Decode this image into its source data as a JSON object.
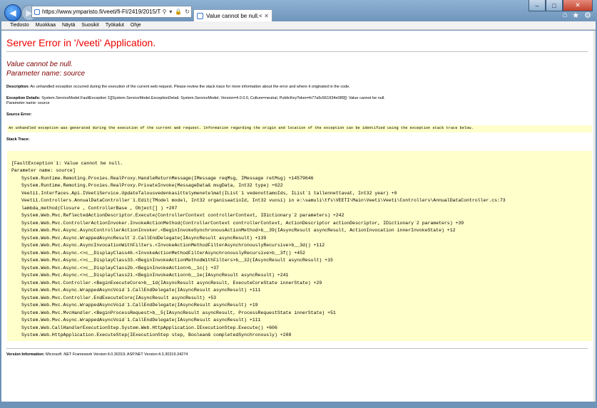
{
  "browser": {
    "url": "https://www.ymparisto.fi/veeti/fi-FI/2419/2015/Talousved",
    "tab_label": "Value cannot be null.<br>P...",
    "menu": [
      "Tiedosto",
      "Muokkaa",
      "Näytä",
      "Suosikit",
      "Työkalut",
      "Ohje"
    ]
  },
  "page": {
    "title": "Server Error in '/veeti' Application.",
    "error_message_line1": "Value cannot be null.",
    "error_message_line2": "Parameter name: source",
    "description_label": "Description:",
    "description_text": "An unhandled exception occurred during the execution of the current web request. Please review the stack trace for more information about the error and where it originated in the code.",
    "exception_label": "Exception Details:",
    "exception_text": "System.ServiceModel.FaultException`1[[System.ServiceModel.ExceptionDetail, System.ServiceModel, Version=4.0.0.0, Culture=neutral, PublicKeyToken=b77a5c561934e089]]: Value cannot be null.",
    "exception_text2": "Parameter name: source",
    "source_error_label": "Source Error:",
    "source_error_text": "An unhandled exception was generated during the execution of the current web request. Information regarding the origin and location of the exception can be identified using the exception stack trace below.",
    "stack_trace_label": "Stack Trace:",
    "stack_trace": [
      "[FaultException`1: Value cannot be null.",
      "Parameter name: source]",
      "System.Runtime.Remoting.Proxies.RealProxy.HandleReturnMessage(IMessage reqMsg, IMessage retMsg) +14579646",
      "System.Runtime.Remoting.Proxies.RealProxy.PrivateInvoke(MessageData& msgData, Int32 type) +622",
      "Veeti1.Interfaces.Api.IVeetiService.UpdateTalousvedenkasittelymenetelmat(IList`1 vedenottamoIds, IList`1 tallennettavat, Int32 year) +0",
      "Veeti1.Controllers.AnnualDataController`1.Edit(TModel model, Int32 organisaatioId, Int32 vuosi) in e:\\samuli\\tfs\\VEETI\\Main\\Veeti\\Veeti\\Controllers\\AnnualDataController.cs:73",
      "lambda_method(Closure , ControllerBase , Object[] ) +207",
      "System.Web.Mvc.ReflectedActionDescriptor.Execute(ControllerContext controllerContext, IDictionary`2 parameters) +242",
      "System.Web.Mvc.ControllerActionInvoker.InvokeActionMethod(ControllerContext controllerContext, ActionDescriptor actionDescriptor, IDictionary`2 parameters) +39",
      "System.Web.Mvc.Async.AsyncControllerActionInvoker.<BeginInvokeSynchronousActionMethod>b__39(IAsyncResult asyncResult, ActionInvocation innerInvokeState) +12",
      "System.Web.Mvc.Async.WrappedAsyncResult`2.CallEndDelegate(IAsyncResult asyncResult) +139",
      "System.Web.Mvc.Async.AsyncInvocationWithFilters.<InvokeActionMethodFilterAsynchronouslyRecursive>b__3d() +112",
      "System.Web.Mvc.Async.<>c__DisplayClass46.<InvokeActionMethodFilterAsynchronouslyRecursive>b__3f() +452",
      "System.Web.Mvc.Async.<>c__DisplayClass33.<BeginInvokeActionMethodWithFilters>b__32(IAsyncResult asyncResult) +15",
      "System.Web.Mvc.Async.<>c__DisplayClass2b.<BeginInvokeAction>b__1c() +37",
      "System.Web.Mvc.Async.<>c__DisplayClass21.<BeginInvokeAction>b__1e(IAsyncResult asyncResult) +241",
      "System.Web.Mvc.Controller.<BeginExecuteCore>b__1d(IAsyncResult asyncResult, ExecuteCoreState innerState) +29",
      "System.Web.Mvc.Async.WrappedAsyncVoid`1.CallEndDelegate(IAsyncResult asyncResult) +111",
      "System.Web.Mvc.Controller.EndExecuteCore(IAsyncResult asyncResult) +53",
      "System.Web.Mvc.Async.WrappedAsyncVoid`1.CallEndDelegate(IAsyncResult asyncResult) +19",
      "System.Web.Mvc.MvcHandler.<BeginProcessRequest>b__5(IAsyncResult asyncResult, ProcessRequestState innerState) +51",
      "System.Web.Mvc.Async.WrappedAsyncVoid`1.CallEndDelegate(IAsyncResult asyncResult) +111",
      "System.Web.CallHandlerExecutionStep.System.Web.HttpApplication.IExecutionStep.Execute() +606",
      "System.Web.HttpApplication.ExecuteStep(IExecutionStep step, Boolean& completedSynchronously) +288"
    ],
    "version_label": "Version Information:",
    "version_text": "Microsoft .NET Framework Version:4.0.30319; ASP.NET Version:4.0.30319.34274"
  }
}
